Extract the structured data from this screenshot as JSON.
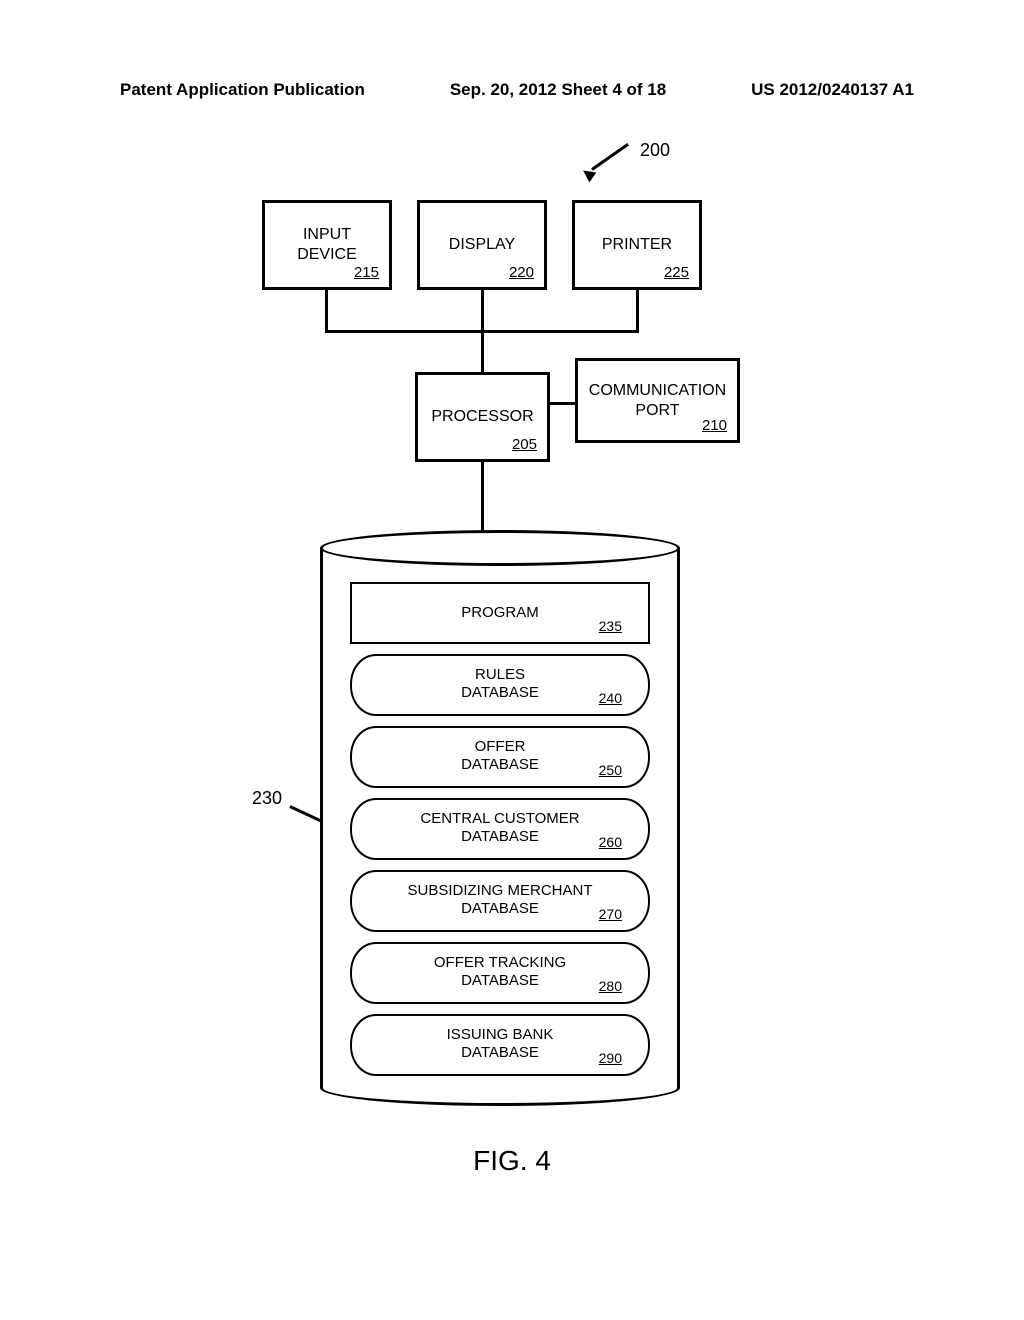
{
  "header": {
    "left": "Patent Application Publication",
    "center": "Sep. 20, 2012  Sheet 4 of 18",
    "right": "US 2012/0240137 A1"
  },
  "system_ref": "200",
  "storage_ref": "230",
  "boxes": {
    "input_device": {
      "label": "INPUT\nDEVICE",
      "ref": "215"
    },
    "display": {
      "label": "DISPLAY",
      "ref": "220"
    },
    "printer": {
      "label": "PRINTER",
      "ref": "225"
    },
    "processor": {
      "label": "PROCESSOR",
      "ref": "205"
    },
    "commport": {
      "label": "COMMUNICATION\nPORT",
      "ref": "210"
    }
  },
  "storage": {
    "items": [
      {
        "label": "PROGRAM",
        "ref": "235",
        "type": "program"
      },
      {
        "label": "RULES\nDATABASE",
        "ref": "240",
        "type": "db"
      },
      {
        "label": "OFFER\nDATABASE",
        "ref": "250",
        "type": "db"
      },
      {
        "label": "CENTRAL CUSTOMER\nDATABASE",
        "ref": "260",
        "type": "db"
      },
      {
        "label": "SUBSIDIZING MERCHANT\nDATABASE",
        "ref": "270",
        "type": "db"
      },
      {
        "label": "OFFER TRACKING\nDATABASE",
        "ref": "280",
        "type": "db"
      },
      {
        "label": "ISSUING BANK\nDATABASE",
        "ref": "290",
        "type": "db"
      }
    ]
  },
  "figure_label": "FIG. 4"
}
